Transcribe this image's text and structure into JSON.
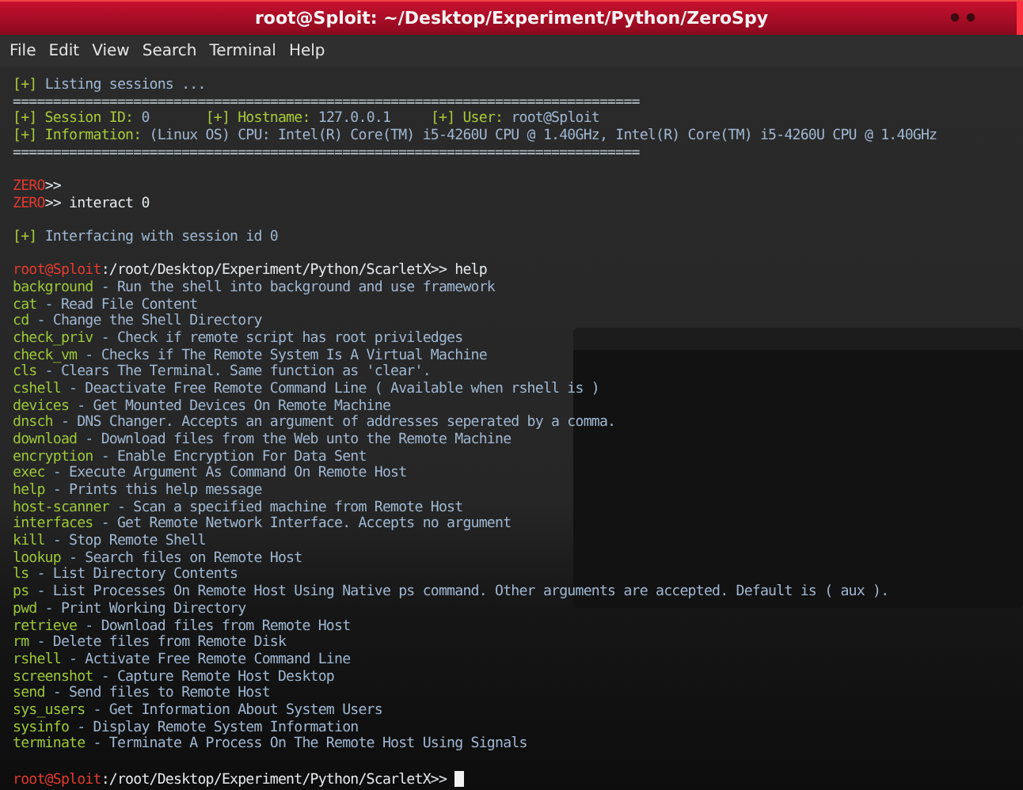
{
  "window": {
    "title": "root@Sploit: ~/Desktop/Experiment/Python/ZeroSpy"
  },
  "menu": [
    {
      "label": "File"
    },
    {
      "label": "Edit"
    },
    {
      "label": "View"
    },
    {
      "label": "Search"
    },
    {
      "label": "Terminal"
    },
    {
      "label": "Help"
    }
  ],
  "lines": [
    {
      "kind": "text",
      "segments": [
        {
          "kind": "tag",
          "text": "[+] "
        },
        {
          "kind": "value",
          "text": "Listing sessions ..."
        }
      ]
    },
    {
      "kind": "rule",
      "segments": [
        {
          "kind": "plain",
          "text": "=============================================================================="
        }
      ]
    },
    {
      "kind": "text",
      "segments": [
        {
          "kind": "tag",
          "text": "[+] Session ID: "
        },
        {
          "kind": "value",
          "text": "0       "
        },
        {
          "kind": "tag",
          "text": "[+] Hostname: "
        },
        {
          "kind": "value",
          "text": "127.0.0.1     "
        },
        {
          "kind": "tag",
          "text": "[+] User: "
        },
        {
          "kind": "value",
          "text": "root@Sploit"
        }
      ]
    },
    {
      "kind": "text",
      "segments": [
        {
          "kind": "tag",
          "text": "[+] Information: "
        },
        {
          "kind": "value",
          "text": "(Linux OS) CPU: Intel(R) Core(TM) i5-4260U CPU @ 1.40GHz, Intel(R) Core(TM) i5-4260U CPU @ 1.40GHz"
        }
      ]
    },
    {
      "kind": "rule",
      "segments": [
        {
          "kind": "plain",
          "text": "=============================================================================="
        }
      ]
    },
    {
      "kind": "blank"
    },
    {
      "kind": "text",
      "segments": [
        {
          "kind": "user",
          "text": "ZERO"
        },
        {
          "kind": "plain",
          "text": ">>"
        }
      ]
    },
    {
      "kind": "text",
      "segments": [
        {
          "kind": "user",
          "text": "ZERO"
        },
        {
          "kind": "plain",
          "text": ">> interact 0"
        }
      ]
    },
    {
      "kind": "blank"
    },
    {
      "kind": "text",
      "segments": [
        {
          "kind": "tag",
          "text": "[+] "
        },
        {
          "kind": "value",
          "text": "Interfacing with session id 0"
        }
      ]
    },
    {
      "kind": "blank"
    },
    {
      "kind": "text",
      "segments": [
        {
          "kind": "user",
          "text": "root@Sploit"
        },
        {
          "kind": "plain",
          "text": ":/root/Desktop/Experiment/Python/ScarletX>> help"
        }
      ]
    },
    {
      "kind": "text",
      "segments": [
        {
          "kind": "command",
          "text": "background"
        },
        {
          "kind": "value",
          "text": " - Run the shell into background and use framework"
        }
      ]
    },
    {
      "kind": "text",
      "segments": [
        {
          "kind": "command",
          "text": "cat"
        },
        {
          "kind": "value",
          "text": " - Read File Content"
        }
      ]
    },
    {
      "kind": "text",
      "segments": [
        {
          "kind": "command",
          "text": "cd"
        },
        {
          "kind": "value",
          "text": " - Change the Shell Directory"
        }
      ]
    },
    {
      "kind": "text",
      "segments": [
        {
          "kind": "command",
          "text": "check_priv"
        },
        {
          "kind": "value",
          "text": " - Check if remote script has root priviledges"
        }
      ]
    },
    {
      "kind": "text",
      "segments": [
        {
          "kind": "command",
          "text": "check_vm"
        },
        {
          "kind": "value",
          "text": " - Checks if The Remote System Is A Virtual Machine"
        }
      ]
    },
    {
      "kind": "text",
      "segments": [
        {
          "kind": "command",
          "text": "cls"
        },
        {
          "kind": "value",
          "text": " - Clears The Terminal. Same function as 'clear'."
        }
      ]
    },
    {
      "kind": "text",
      "segments": [
        {
          "kind": "command",
          "text": "cshell"
        },
        {
          "kind": "value",
          "text": " - Deactivate Free Remote Command Line ( Available when rshell is )"
        }
      ]
    },
    {
      "kind": "text",
      "segments": [
        {
          "kind": "command",
          "text": "devices"
        },
        {
          "kind": "value",
          "text": " - Get Mounted Devices On Remote Machine"
        }
      ]
    },
    {
      "kind": "text",
      "segments": [
        {
          "kind": "command",
          "text": "dnsch"
        },
        {
          "kind": "value",
          "text": " - DNS Changer. Accepts an argument of addresses seperated by a comma."
        }
      ]
    },
    {
      "kind": "text",
      "segments": [
        {
          "kind": "command",
          "text": "download"
        },
        {
          "kind": "value",
          "text": " - Download files from the Web unto the Remote Machine"
        }
      ]
    },
    {
      "kind": "text",
      "segments": [
        {
          "kind": "command",
          "text": "encryption"
        },
        {
          "kind": "value",
          "text": " - Enable Encryption For Data Sent"
        }
      ]
    },
    {
      "kind": "text",
      "segments": [
        {
          "kind": "command",
          "text": "exec"
        },
        {
          "kind": "value",
          "text": " - Execute Argument As Command On Remote Host"
        }
      ]
    },
    {
      "kind": "text",
      "segments": [
        {
          "kind": "command",
          "text": "help"
        },
        {
          "kind": "value",
          "text": " - Prints this help message"
        }
      ]
    },
    {
      "kind": "text",
      "segments": [
        {
          "kind": "command",
          "text": "host-scanner"
        },
        {
          "kind": "value",
          "text": " - Scan a specified machine from Remote Host"
        }
      ]
    },
    {
      "kind": "text",
      "segments": [
        {
          "kind": "command",
          "text": "interfaces"
        },
        {
          "kind": "value",
          "text": " - Get Remote Network Interface. Accepts no argument"
        }
      ]
    },
    {
      "kind": "text",
      "segments": [
        {
          "kind": "command",
          "text": "kill"
        },
        {
          "kind": "value",
          "text": " - Stop Remote Shell"
        }
      ]
    },
    {
      "kind": "text",
      "segments": [
        {
          "kind": "command",
          "text": "lookup"
        },
        {
          "kind": "value",
          "text": " - Search files on Remote Host"
        }
      ]
    },
    {
      "kind": "text",
      "segments": [
        {
          "kind": "command",
          "text": "ls"
        },
        {
          "kind": "value",
          "text": " - List Directory Contents"
        }
      ]
    },
    {
      "kind": "text",
      "segments": [
        {
          "kind": "command",
          "text": "ps"
        },
        {
          "kind": "value",
          "text": " - List Processes On Remote Host Using Native ps command. Other arguments are accepted. Default is ( aux )."
        }
      ]
    },
    {
      "kind": "text",
      "segments": [
        {
          "kind": "command",
          "text": "pwd"
        },
        {
          "kind": "value",
          "text": " - Print Working Directory"
        }
      ]
    },
    {
      "kind": "text",
      "segments": [
        {
          "kind": "command",
          "text": "retrieve"
        },
        {
          "kind": "value",
          "text": " - Download files from Remote Host"
        }
      ]
    },
    {
      "kind": "text",
      "segments": [
        {
          "kind": "command",
          "text": "rm"
        },
        {
          "kind": "value",
          "text": " - Delete files from Remote Disk"
        }
      ]
    },
    {
      "kind": "text",
      "segments": [
        {
          "kind": "command",
          "text": "rshell"
        },
        {
          "kind": "value",
          "text": " - Activate Free Remote Command Line"
        }
      ]
    },
    {
      "kind": "text",
      "segments": [
        {
          "kind": "command",
          "text": "screenshot"
        },
        {
          "kind": "value",
          "text": " - Capture Remote Host Desktop"
        }
      ]
    },
    {
      "kind": "text",
      "segments": [
        {
          "kind": "command",
          "text": "send"
        },
        {
          "kind": "value",
          "text": " - Send files to Remote Host"
        }
      ]
    },
    {
      "kind": "text",
      "segments": [
        {
          "kind": "command",
          "text": "sys_users"
        },
        {
          "kind": "value",
          "text": " - Get Information About System Users"
        }
      ]
    },
    {
      "kind": "text",
      "segments": [
        {
          "kind": "command",
          "text": "sysinfo"
        },
        {
          "kind": "value",
          "text": " - Display Remote System Information"
        }
      ]
    },
    {
      "kind": "text",
      "segments": [
        {
          "kind": "command",
          "text": "terminate"
        },
        {
          "kind": "value",
          "text": " - Terminate A Process On The Remote Host Using Signals"
        }
      ]
    },
    {
      "kind": "blank"
    },
    {
      "kind": "text",
      "cursor": true,
      "segments": [
        {
          "kind": "user",
          "text": "root@Sploit"
        },
        {
          "kind": "plain",
          "text": ":/root/Desktop/Experiment/Python/ScarletX>> "
        }
      ]
    }
  ]
}
